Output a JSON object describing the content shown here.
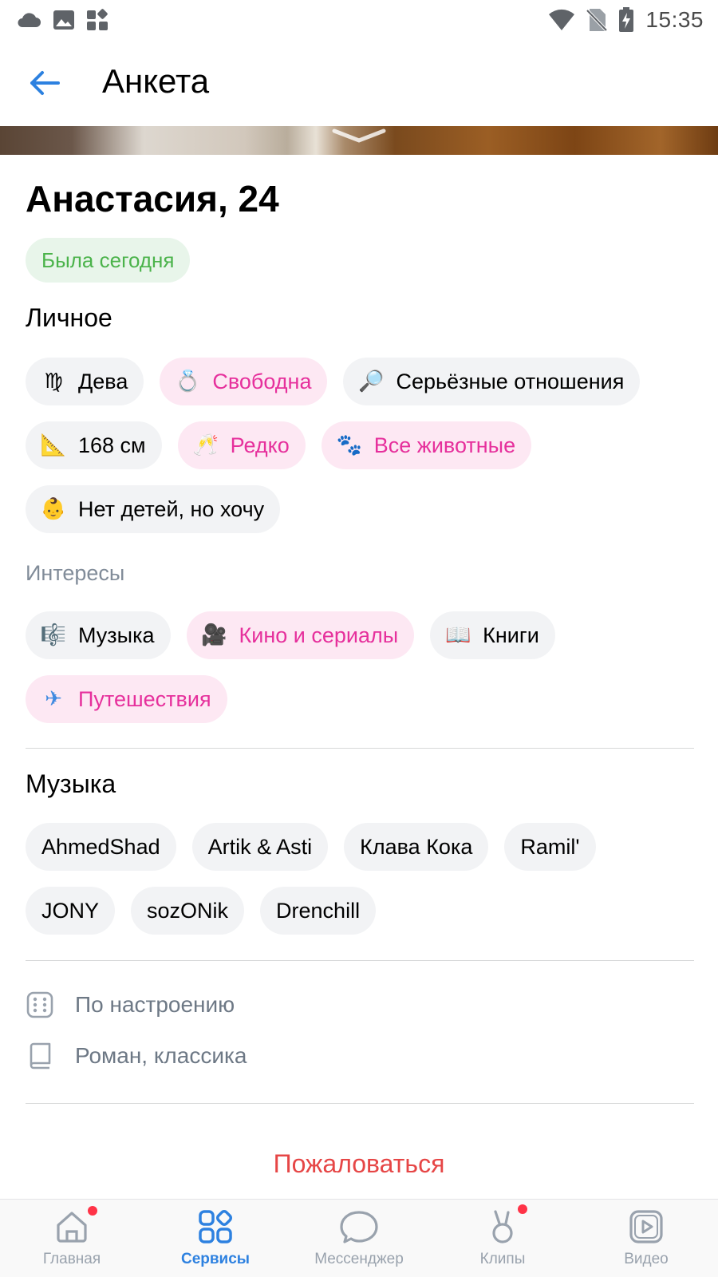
{
  "status_bar": {
    "time": "15:35",
    "left_icons": [
      "cloud-icon",
      "image-icon",
      "apps-icon"
    ],
    "right_icons": [
      "wifi-icon",
      "no-sim-icon",
      "battery-charging-icon"
    ]
  },
  "header": {
    "title": "Анкета",
    "back_icon": "arrow-left-icon"
  },
  "profile": {
    "name": "Анастасия, 24",
    "online_status": "Была сегодня"
  },
  "personal": {
    "title": "Личное",
    "chips": [
      {
        "emoji": "♍",
        "label": "Дева",
        "highlight": false
      },
      {
        "emoji": "💍",
        "label": "Свободна",
        "highlight": true
      },
      {
        "emoji": "🔎",
        "label": "Серьёзные отношения",
        "highlight": false
      },
      {
        "emoji": "📐",
        "label": "168 см",
        "highlight": false
      },
      {
        "emoji": "🥂",
        "label": "Редко",
        "highlight": true
      },
      {
        "emoji": "🐾",
        "label": "Все животные",
        "highlight": true
      },
      {
        "emoji": "👶",
        "label": "Нет детей, но хочу",
        "highlight": false
      }
    ]
  },
  "interests": {
    "title": "Интересы",
    "chips": [
      {
        "emoji": "🎼",
        "label": "Музыка",
        "highlight": false
      },
      {
        "emoji": "🎥",
        "label": "Кино и сериалы",
        "highlight": true
      },
      {
        "emoji": "📖",
        "label": "Книги",
        "highlight": false
      },
      {
        "emoji": "✈",
        "label": "Путешествия",
        "highlight": true
      }
    ]
  },
  "music": {
    "title": "Музыка",
    "artists": [
      "AhmedShad",
      "Artik & Asti",
      "Клава Кока",
      "Ramil'",
      "JONY",
      "sozONik",
      "Drenchill"
    ]
  },
  "details": [
    {
      "icon": "dice-icon",
      "text": "По настроению"
    },
    {
      "icon": "book-icon",
      "text": "Роман, классика"
    }
  ],
  "report_label": "Пожаловаться",
  "bottom_nav": [
    {
      "label": "Главная",
      "icon": "home-icon",
      "active": false,
      "badge": true
    },
    {
      "label": "Сервисы",
      "icon": "services-icon",
      "active": true,
      "badge": false
    },
    {
      "label": "Мессенджер",
      "icon": "message-icon",
      "active": false,
      "badge": false
    },
    {
      "label": "Клипы",
      "icon": "clips-icon",
      "active": false,
      "badge": true
    },
    {
      "label": "Видео",
      "icon": "video-icon",
      "active": false,
      "badge": false
    }
  ],
  "colors": {
    "accent": "#2d81e0",
    "highlight_text": "#e6309c",
    "highlight_bg": "#fde8f3",
    "online": "#4bb34b",
    "report": "#e64646",
    "badge": "#ff3347"
  }
}
